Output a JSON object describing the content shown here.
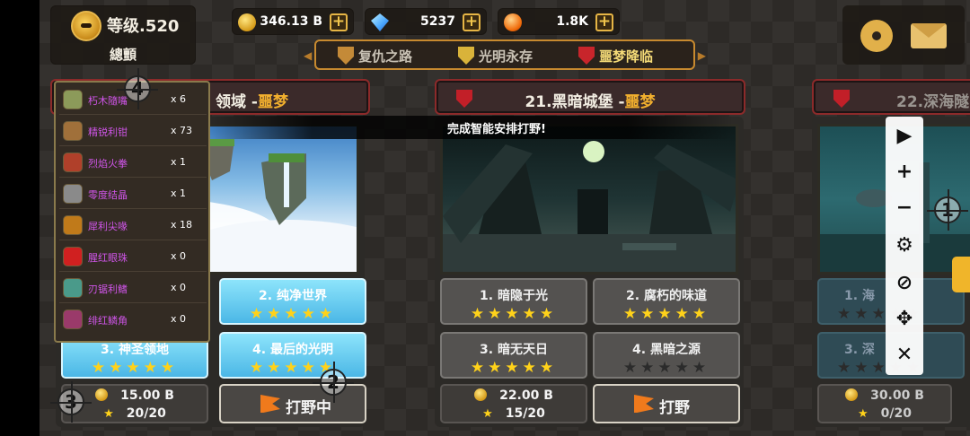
{
  "player": {
    "level": "等级.520",
    "name": "總顫"
  },
  "resources": [
    {
      "icon": "gold-coin-icon",
      "value": "346.13 B"
    },
    {
      "icon": "diamond-icon",
      "value": "5237"
    },
    {
      "icon": "fire-orb-icon",
      "value": "1.8K"
    }
  ],
  "modes": [
    "复仇之路",
    "光明永存",
    "噩梦降临"
  ],
  "active_mode": "噩梦降临",
  "toast": "完成智能安排打野!",
  "difficulty_label": "噩梦",
  "cards": [
    {
      "title": "领域 -",
      "stages": [
        {
          "label": "2. 纯净世界",
          "stars": "★★★★★"
        },
        {
          "label": "3. 神圣领地",
          "stars": "★★★★★"
        },
        {
          "label": "4. 最后的光明",
          "stars": "★★★★★"
        }
      ],
      "cost": "15.00 B",
      "progress": "20/20",
      "action": "打野中"
    },
    {
      "title": "21.黑暗城堡 -",
      "stages": [
        {
          "label": "1. 暗隐于光",
          "stars": "★★★★★"
        },
        {
          "label": "2. 腐朽的味道",
          "stars": "★★★★★"
        },
        {
          "label": "3. 暗无天日",
          "stars": "★★★★★"
        },
        {
          "label": "4. 黑暗之源",
          "stars": "★★★★★"
        }
      ],
      "cost": "22.00 B",
      "progress": "15/20",
      "action": "打野"
    },
    {
      "title": "22.深海隧",
      "stages": [
        {
          "label": "1. 海",
          "stars": "★★★★★"
        },
        {
          "label": "3. 深",
          "stars": "★★★★★"
        }
      ],
      "cost": "30.00 B",
      "progress": "0/20"
    }
  ],
  "drops": [
    {
      "name": "朽木隨嘴",
      "qty": "x 6",
      "color": "#8c9a5a"
    },
    {
      "name": "精锐利钳",
      "qty": "x 73",
      "color": "#a0703a"
    },
    {
      "name": "烈焰火拳",
      "qty": "x 1",
      "color": "#b0402a"
    },
    {
      "name": "零度结晶",
      "qty": "x 1",
      "color": "#8a8a8a"
    },
    {
      "name": "犀利尖喙",
      "qty": "x 18",
      "color": "#c07a1a"
    },
    {
      "name": "腥红眼珠",
      "qty": "x 0",
      "color": "#d02020"
    },
    {
      "name": "刃锯利鳍",
      "qty": "x 0",
      "color": "#4a9a8a"
    },
    {
      "name": "绯红鳞角",
      "qty": "x 0",
      "color": "#9a3a6a"
    }
  ],
  "markers": [
    "4",
    "3",
    "2",
    "1"
  ],
  "tools": [
    "▶",
    "+",
    "−",
    "⚙",
    "⊘",
    "✥",
    "✕"
  ]
}
